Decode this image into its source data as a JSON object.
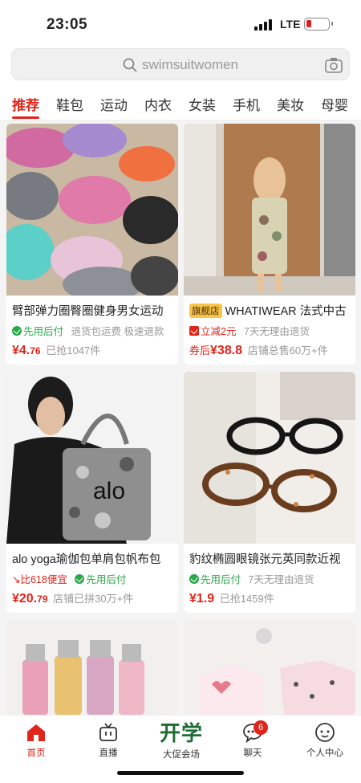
{
  "status": {
    "time": "23:05",
    "network": "LTE"
  },
  "search": {
    "placeholder": "swimsuitwomen"
  },
  "tabs": [
    "推荐",
    "鞋包",
    "运动",
    "内衣",
    "女装",
    "手机",
    "美妆",
    "母婴"
  ],
  "products": [
    {
      "title": "臂部弹力圈臀圈健身男女运动",
      "flag": "",
      "perk": "先用后付",
      "notes": "退货包运费  极速退款",
      "price_prefix": "",
      "price_int": "¥4.",
      "price_dec": "76",
      "extra": "已抢1047件"
    },
    {
      "title": "WHATIWEAR 法式中古",
      "flag": "旗舰店",
      "perk": "立减2元",
      "notes": "7天无理由退货",
      "price_prefix": "券后",
      "price_int": "¥38.",
      "price_dec": "8",
      "extra": "店铺总售60万+件"
    },
    {
      "title": "alo yoga瑜伽包单肩包帆布包",
      "flag": "",
      "perk": "比618便宜",
      "perk2": "先用后付",
      "notes": "",
      "price_prefix": "",
      "price_int": "¥20.",
      "price_dec": "79",
      "extra": "店铺已拼30万+件"
    },
    {
      "title": "豹纹椭圆眼镜张元英同款近视",
      "flag": "",
      "perk": "先用后付",
      "notes": "7天无理由退货",
      "price_prefix": "",
      "price_int": "¥1.",
      "price_dec": "9",
      "extra": "已抢1459件"
    }
  ],
  "tabbar": {
    "home": "首页",
    "live": "直播",
    "promo_big": "开学",
    "promo": "大促会场",
    "chat": "聊天",
    "chat_badge": "6",
    "me": "个人中心"
  },
  "colors": {
    "accent": "#e0251b",
    "green": "#2aa84a",
    "promo": "#1f6b34"
  }
}
